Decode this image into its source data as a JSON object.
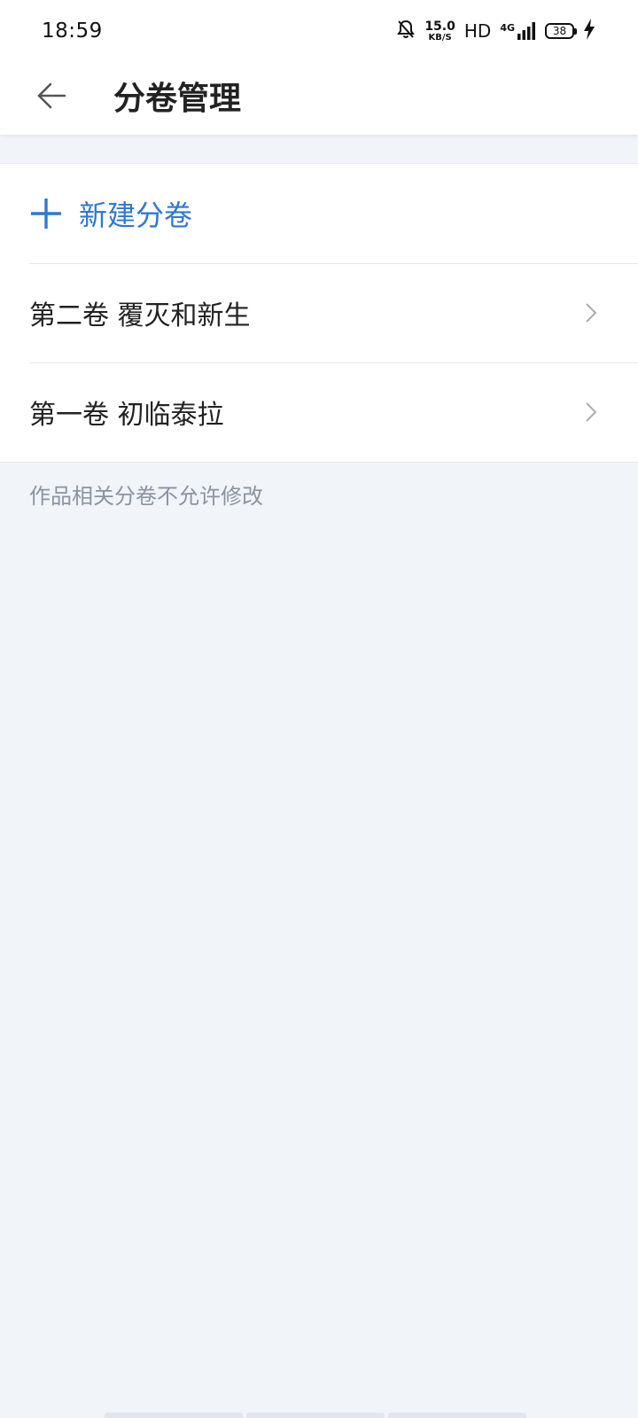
{
  "status_bar": {
    "time": "18:59",
    "speed_value": "15.0",
    "speed_unit": "KB/S",
    "hd": "HD",
    "network": "4G",
    "battery": "38",
    "icons": [
      "mute-bell-icon",
      "signal-icon",
      "battery-icon",
      "charging-bolt-icon"
    ]
  },
  "app_bar": {
    "back_icon": "arrow-left-icon",
    "title": "分卷管理"
  },
  "list": {
    "new_volume_label": "新建分卷",
    "new_volume_icon": "plus-icon",
    "volumes": [
      {
        "label": "第二卷 覆灭和新生"
      },
      {
        "label": "第一卷 初临泰拉"
      }
    ]
  },
  "hint": "作品相关分卷不允许修改",
  "colors": {
    "accent": "#2f78d4",
    "background": "#f1f4f9",
    "surface": "#ffffff",
    "hint_text": "#8a93a1",
    "divider": "#e6e9ee"
  }
}
